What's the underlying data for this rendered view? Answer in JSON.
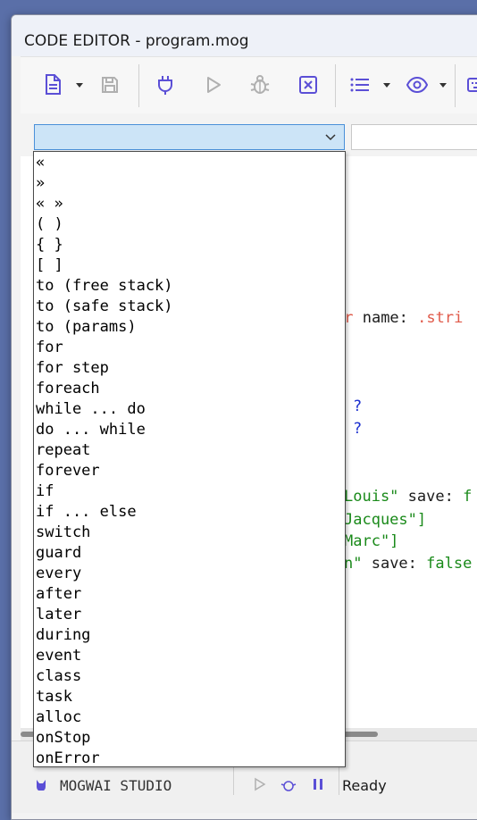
{
  "window": {
    "title": "CODE EDITOR - program.mog"
  },
  "toolbar": {
    "buttons": [
      {
        "icon": "document-icon"
      },
      {
        "icon": "save-icon"
      },
      {
        "icon": "plug-icon"
      },
      {
        "icon": "play-icon"
      },
      {
        "icon": "bug-icon"
      },
      {
        "icon": "close-box-icon"
      },
      {
        "icon": "list-icon"
      },
      {
        "icon": "eye-icon"
      },
      {
        "icon": "keyboard-icon"
      }
    ]
  },
  "combo": {
    "selected": ""
  },
  "editor": {
    "lines": [
      {
        "segments": [
          {
            "text": "er ",
            "color": "#e05a4a"
          },
          {
            "text": "name: ",
            "color": "#1a1a1a"
          },
          {
            "text": ".stri",
            "color": "#e05a4a"
          }
        ]
      },
      {
        "segments": [
          {
            "text": "?",
            "color": "#1b2fcf"
          }
        ]
      },
      {
        "segments": [
          {
            "text": "?",
            "color": "#1b2fcf"
          }
        ]
      },
      {
        "segments": [
          {
            "text": "Louis\"",
            "color": "#1a8a1a"
          },
          {
            "text": " save: ",
            "color": "#1a1a1a"
          },
          {
            "text": "f",
            "color": "#1a8a1a"
          }
        ]
      },
      {
        "segments": [
          {
            "text": "Jacques\"]",
            "color": "#1a8a1a"
          }
        ]
      },
      {
        "segments": [
          {
            "text": "Marc\"]",
            "color": "#1a8a1a"
          }
        ]
      },
      {
        "segments": [
          {
            "text": "n\"",
            "color": "#1a8a1a"
          },
          {
            "text": " save: ",
            "color": "#1a1a1a"
          },
          {
            "text": "false",
            "color": "#1a8a1a"
          }
        ]
      }
    ]
  },
  "statusbar": {
    "app_name": "MOGWAI STUDIO",
    "status": "Ready"
  },
  "dropdown": {
    "items": [
      "«",
      "»",
      "« »",
      "( )",
      "{ }",
      "[ ]",
      "to (free stack)",
      "to (safe stack)",
      "to (params)",
      "for",
      "for step",
      "foreach",
      "while ... do",
      "do ... while",
      "repeat",
      "forever",
      "if",
      "if ... else",
      "switch",
      "guard",
      "every",
      "after",
      "later",
      "during",
      "event",
      "class",
      "task",
      "alloc",
      "onStop",
      "onError"
    ]
  }
}
